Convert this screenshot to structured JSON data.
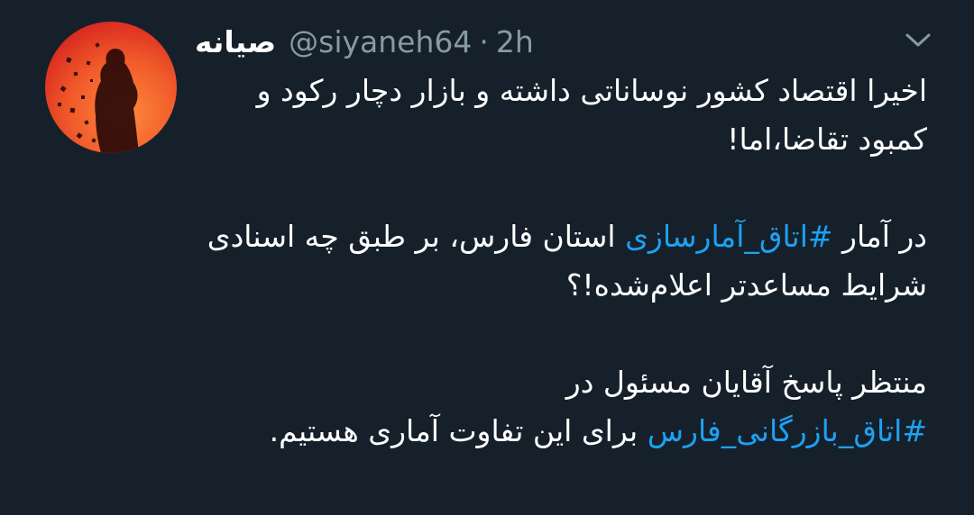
{
  "tweet": {
    "display_name": "صیانه",
    "handle": "@siyaneh64",
    "separator": "·",
    "time": "2h",
    "paragraph1": "اخیرا اقتصاد کشور نوساناتی داشته و بازار دچار رکود و کمبود تقاضا،اما!",
    "paragraph2_before": "در آمار ",
    "paragraph2_hashtag": "#اتاق_آمارسازی",
    "paragraph2_after": " استان فارس، بر طبق چه اسنادی شرایط مساعدتر اعلام‌شده!؟",
    "paragraph3_line1": "منتظر پاسخ آقایان مسئول در",
    "paragraph3_hashtag": "#اتاق_بازرگانی_فارس",
    "paragraph3_after": " برای این تفاوت آماری هستیم."
  },
  "icons": {
    "avatar": "profile-avatar",
    "menu": "chevron-down-icon"
  },
  "colors": {
    "background": "#15202b",
    "text": "#ffffff",
    "secondary": "#8899a6",
    "hashtag": "#1da1f2"
  }
}
